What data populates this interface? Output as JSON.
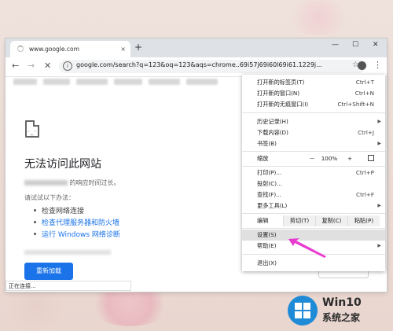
{
  "tab": {
    "title": "www.google.com",
    "close": "×",
    "new_tab": "+"
  },
  "window_controls": {
    "minimize": "—",
    "maximize": "☐",
    "close": "✕"
  },
  "toolbar": {
    "back": "←",
    "forward": "→",
    "stop": "✕",
    "url": "google.com/search?q=123&oq=123&aqs=chrome..69i57j69i60l69i61.1229j...",
    "star": "☆",
    "menu": "⋮"
  },
  "error_page": {
    "face": "·_·",
    "title": "无法访问此网站",
    "subtitle": " 的响应时间过长。",
    "try_label": "请试试以下办法：",
    "suggestions": [
      "检查网络连接",
      "检查代理服务器和防火墙",
      "运行 Windows 网络诊断"
    ],
    "reload": "重新加载"
  },
  "status": "正在连接...",
  "menu": {
    "new_tab": "打开新的标签页(T)",
    "new_tab_key": "Ctrl+T",
    "new_window": "打开新的窗口(N)",
    "new_window_key": "Ctrl+N",
    "incognito": "打开新的无痕窗口(I)",
    "incognito_key": "Ctrl+Shift+N",
    "history": "历史记录(H)",
    "downloads": "下载内容(D)",
    "downloads_key": "Ctrl+J",
    "bookmarks": "书签(B)",
    "zoom": "缩放",
    "zoom_minus": "－",
    "zoom_value": "100%",
    "zoom_plus": "+",
    "print": "打印(P)...",
    "print_key": "Ctrl+P",
    "cast": "投射(C)...",
    "find": "查找(F)...",
    "find_key": "Ctrl+F",
    "more_tools": "更多工具(L)",
    "edit": "编辑",
    "cut": "剪切(T)",
    "copy": "复制(C)",
    "paste": "粘贴(P)",
    "settings": "设置(S)",
    "help": "帮助(E)",
    "exit": "退出(X)"
  },
  "watermark": {
    "title": "Win10",
    "subtitle": "系统之家"
  }
}
